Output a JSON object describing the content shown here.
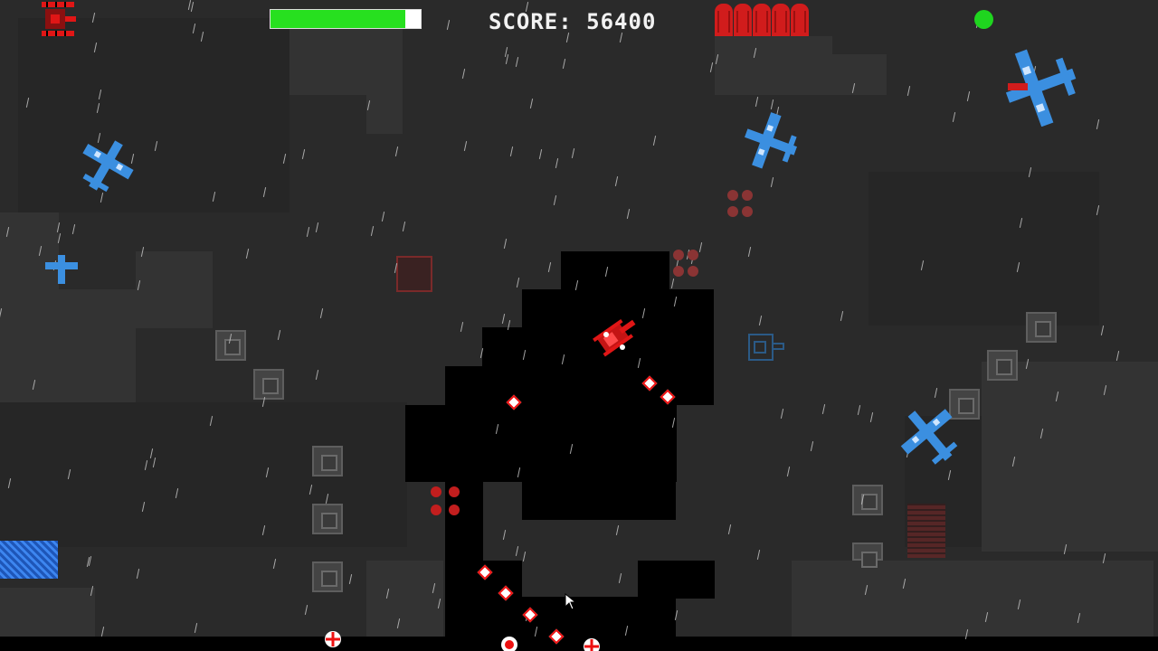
{
  "hud": {
    "score_label": "SCORE: 56400",
    "health_fraction": 0.9,
    "health_color": "#27e01f",
    "ammo_shells": 5,
    "ammo_color": "#d11c1c",
    "status_color": "#1fd51f"
  },
  "icons": {
    "player_life": "red-tank-icon",
    "enemy_plane": "blue-plane-icon",
    "player_tank": "red-tank-icon",
    "cursor": "mouse-cursor-icon"
  },
  "colors": {
    "player": "#e01616",
    "enemy": "#3b8fe0",
    "void": "#000000"
  }
}
